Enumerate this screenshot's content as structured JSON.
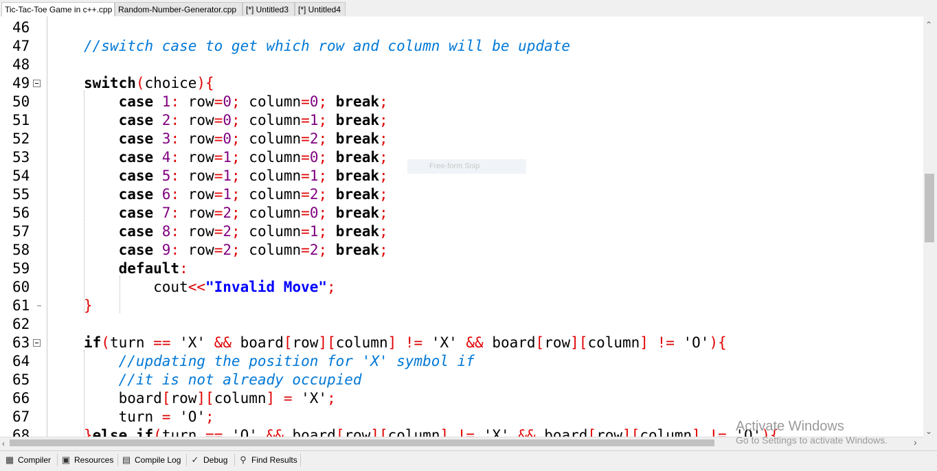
{
  "tabs": [
    {
      "label": "Tic-Tac-Toe Game in c++.cpp",
      "active": true
    },
    {
      "label": "Random-Number-Generator.cpp",
      "active": false
    },
    {
      "label": "[*] Untitled3",
      "active": false
    },
    {
      "label": "[*] Untitled4",
      "active": false
    }
  ],
  "editor": {
    "lines": [
      {
        "num": "46",
        "tokens": []
      },
      {
        "num": "47",
        "tokens": [
          {
            "t": "//switch case to get which row and column will be update",
            "c": "cmt"
          }
        ]
      },
      {
        "num": "48",
        "tokens": []
      },
      {
        "num": "49",
        "fold": true,
        "tokens": [
          {
            "t": "switch",
            "c": "kw"
          },
          {
            "t": "(",
            "c": "op"
          },
          {
            "t": "choice",
            "c": "id"
          },
          {
            "t": "){",
            "c": "op"
          }
        ]
      },
      {
        "num": "50",
        "tokens": [
          {
            "t": "    case ",
            "c": "kw"
          },
          {
            "t": "1",
            "c": "num"
          },
          {
            "t": ": ",
            "c": "op"
          },
          {
            "t": "row",
            "c": "id"
          },
          {
            "t": "=",
            "c": "op"
          },
          {
            "t": "0",
            "c": "num"
          },
          {
            "t": "; ",
            "c": "op"
          },
          {
            "t": "column",
            "c": "id"
          },
          {
            "t": "=",
            "c": "op"
          },
          {
            "t": "0",
            "c": "num"
          },
          {
            "t": "; ",
            "c": "op"
          },
          {
            "t": "break",
            "c": "kw"
          },
          {
            "t": ";",
            "c": "op"
          }
        ]
      },
      {
        "num": "51",
        "tokens": [
          {
            "t": "    case ",
            "c": "kw"
          },
          {
            "t": "2",
            "c": "num"
          },
          {
            "t": ": ",
            "c": "op"
          },
          {
            "t": "row",
            "c": "id"
          },
          {
            "t": "=",
            "c": "op"
          },
          {
            "t": "0",
            "c": "num"
          },
          {
            "t": "; ",
            "c": "op"
          },
          {
            "t": "column",
            "c": "id"
          },
          {
            "t": "=",
            "c": "op"
          },
          {
            "t": "1",
            "c": "num"
          },
          {
            "t": "; ",
            "c": "op"
          },
          {
            "t": "break",
            "c": "kw"
          },
          {
            "t": ";",
            "c": "op"
          }
        ]
      },
      {
        "num": "52",
        "tokens": [
          {
            "t": "    case ",
            "c": "kw"
          },
          {
            "t": "3",
            "c": "num"
          },
          {
            "t": ": ",
            "c": "op"
          },
          {
            "t": "row",
            "c": "id"
          },
          {
            "t": "=",
            "c": "op"
          },
          {
            "t": "0",
            "c": "num"
          },
          {
            "t": "; ",
            "c": "op"
          },
          {
            "t": "column",
            "c": "id"
          },
          {
            "t": "=",
            "c": "op"
          },
          {
            "t": "2",
            "c": "num"
          },
          {
            "t": "; ",
            "c": "op"
          },
          {
            "t": "break",
            "c": "kw"
          },
          {
            "t": ";",
            "c": "op"
          }
        ]
      },
      {
        "num": "53",
        "tokens": [
          {
            "t": "    case ",
            "c": "kw"
          },
          {
            "t": "4",
            "c": "num"
          },
          {
            "t": ": ",
            "c": "op"
          },
          {
            "t": "row",
            "c": "id"
          },
          {
            "t": "=",
            "c": "op"
          },
          {
            "t": "1",
            "c": "num"
          },
          {
            "t": "; ",
            "c": "op"
          },
          {
            "t": "column",
            "c": "id"
          },
          {
            "t": "=",
            "c": "op"
          },
          {
            "t": "0",
            "c": "num"
          },
          {
            "t": "; ",
            "c": "op"
          },
          {
            "t": "break",
            "c": "kw"
          },
          {
            "t": ";",
            "c": "op"
          }
        ]
      },
      {
        "num": "54",
        "tokens": [
          {
            "t": "    case ",
            "c": "kw"
          },
          {
            "t": "5",
            "c": "num"
          },
          {
            "t": ": ",
            "c": "op"
          },
          {
            "t": "row",
            "c": "id"
          },
          {
            "t": "=",
            "c": "op"
          },
          {
            "t": "1",
            "c": "num"
          },
          {
            "t": "; ",
            "c": "op"
          },
          {
            "t": "column",
            "c": "id"
          },
          {
            "t": "=",
            "c": "op"
          },
          {
            "t": "1",
            "c": "num"
          },
          {
            "t": "; ",
            "c": "op"
          },
          {
            "t": "break",
            "c": "kw"
          },
          {
            "t": ";",
            "c": "op"
          }
        ]
      },
      {
        "num": "55",
        "tokens": [
          {
            "t": "    case ",
            "c": "kw"
          },
          {
            "t": "6",
            "c": "num"
          },
          {
            "t": ": ",
            "c": "op"
          },
          {
            "t": "row",
            "c": "id"
          },
          {
            "t": "=",
            "c": "op"
          },
          {
            "t": "1",
            "c": "num"
          },
          {
            "t": "; ",
            "c": "op"
          },
          {
            "t": "column",
            "c": "id"
          },
          {
            "t": "=",
            "c": "op"
          },
          {
            "t": "2",
            "c": "num"
          },
          {
            "t": "; ",
            "c": "op"
          },
          {
            "t": "break",
            "c": "kw"
          },
          {
            "t": ";",
            "c": "op"
          }
        ]
      },
      {
        "num": "56",
        "tokens": [
          {
            "t": "    case ",
            "c": "kw"
          },
          {
            "t": "7",
            "c": "num"
          },
          {
            "t": ": ",
            "c": "op"
          },
          {
            "t": "row",
            "c": "id"
          },
          {
            "t": "=",
            "c": "op"
          },
          {
            "t": "2",
            "c": "num"
          },
          {
            "t": "; ",
            "c": "op"
          },
          {
            "t": "column",
            "c": "id"
          },
          {
            "t": "=",
            "c": "op"
          },
          {
            "t": "0",
            "c": "num"
          },
          {
            "t": "; ",
            "c": "op"
          },
          {
            "t": "break",
            "c": "kw"
          },
          {
            "t": ";",
            "c": "op"
          }
        ]
      },
      {
        "num": "57",
        "tokens": [
          {
            "t": "    case ",
            "c": "kw"
          },
          {
            "t": "8",
            "c": "num"
          },
          {
            "t": ": ",
            "c": "op"
          },
          {
            "t": "row",
            "c": "id"
          },
          {
            "t": "=",
            "c": "op"
          },
          {
            "t": "2",
            "c": "num"
          },
          {
            "t": "; ",
            "c": "op"
          },
          {
            "t": "column",
            "c": "id"
          },
          {
            "t": "=",
            "c": "op"
          },
          {
            "t": "1",
            "c": "num"
          },
          {
            "t": "; ",
            "c": "op"
          },
          {
            "t": "break",
            "c": "kw"
          },
          {
            "t": ";",
            "c": "op"
          }
        ]
      },
      {
        "num": "58",
        "tokens": [
          {
            "t": "    case ",
            "c": "kw"
          },
          {
            "t": "9",
            "c": "num"
          },
          {
            "t": ": ",
            "c": "op"
          },
          {
            "t": "row",
            "c": "id"
          },
          {
            "t": "=",
            "c": "op"
          },
          {
            "t": "2",
            "c": "num"
          },
          {
            "t": "; ",
            "c": "op"
          },
          {
            "t": "column",
            "c": "id"
          },
          {
            "t": "=",
            "c": "op"
          },
          {
            "t": "2",
            "c": "num"
          },
          {
            "t": "; ",
            "c": "op"
          },
          {
            "t": "break",
            "c": "kw"
          },
          {
            "t": ";",
            "c": "op"
          }
        ]
      },
      {
        "num": "59",
        "tokens": [
          {
            "t": "    default",
            "c": "kw"
          },
          {
            "t": ":",
            "c": "op"
          }
        ]
      },
      {
        "num": "60",
        "tokens": [
          {
            "t": "        cout",
            "c": "id"
          },
          {
            "t": "<<",
            "c": "op"
          },
          {
            "t": "\"Invalid Move\"",
            "c": "str"
          },
          {
            "t": ";",
            "c": "op"
          }
        ]
      },
      {
        "num": "61",
        "foldEnd": true,
        "tokens": [
          {
            "t": "}",
            "c": "op"
          }
        ]
      },
      {
        "num": "62",
        "tokens": []
      },
      {
        "num": "63",
        "fold": true,
        "tokens": [
          {
            "t": "if",
            "c": "kw"
          },
          {
            "t": "(",
            "c": "op"
          },
          {
            "t": "turn ",
            "c": "id"
          },
          {
            "t": "==",
            "c": "op"
          },
          {
            "t": " 'X' ",
            "c": "chr"
          },
          {
            "t": "&&",
            "c": "op"
          },
          {
            "t": " board",
            "c": "id"
          },
          {
            "t": "[",
            "c": "op"
          },
          {
            "t": "row",
            "c": "id"
          },
          {
            "t": "][",
            "c": "op"
          },
          {
            "t": "column",
            "c": "id"
          },
          {
            "t": "] != ",
            "c": "op"
          },
          {
            "t": "'X' ",
            "c": "chr"
          },
          {
            "t": "&&",
            "c": "op"
          },
          {
            "t": " board",
            "c": "id"
          },
          {
            "t": "[",
            "c": "op"
          },
          {
            "t": "row",
            "c": "id"
          },
          {
            "t": "][",
            "c": "op"
          },
          {
            "t": "column",
            "c": "id"
          },
          {
            "t": "] != ",
            "c": "op"
          },
          {
            "t": "'O'",
            "c": "chr"
          },
          {
            "t": "){",
            "c": "op"
          }
        ]
      },
      {
        "num": "64",
        "tokens": [
          {
            "t": "    //updating the position for 'X' symbol if",
            "c": "cmt"
          }
        ]
      },
      {
        "num": "65",
        "tokens": [
          {
            "t": "    //it is not already occupied",
            "c": "cmt"
          }
        ]
      },
      {
        "num": "66",
        "tokens": [
          {
            "t": "    board",
            "c": "id"
          },
          {
            "t": "[",
            "c": "op"
          },
          {
            "t": "row",
            "c": "id"
          },
          {
            "t": "][",
            "c": "op"
          },
          {
            "t": "column",
            "c": "id"
          },
          {
            "t": "] = ",
            "c": "op"
          },
          {
            "t": "'X'",
            "c": "chr"
          },
          {
            "t": ";",
            "c": "op"
          }
        ]
      },
      {
        "num": "67",
        "tokens": [
          {
            "t": "    turn ",
            "c": "id"
          },
          {
            "t": "=",
            "c": "op"
          },
          {
            "t": " 'O'",
            "c": "chr"
          },
          {
            "t": ";",
            "c": "op"
          }
        ]
      },
      {
        "num": "68",
        "tokens": [
          {
            "t": "}",
            "c": "op"
          },
          {
            "t": "else ",
            "c": "kw"
          },
          {
            "t": "if",
            "c": "kw"
          },
          {
            "t": "(",
            "c": "op"
          },
          {
            "t": "turn ",
            "c": "id"
          },
          {
            "t": "==",
            "c": "op"
          },
          {
            "t": " 'O' ",
            "c": "chr"
          },
          {
            "t": "&&",
            "c": "op"
          },
          {
            "t": " board",
            "c": "id"
          },
          {
            "t": "[",
            "c": "op"
          },
          {
            "t": "row",
            "c": "id"
          },
          {
            "t": "][",
            "c": "op"
          },
          {
            "t": "column",
            "c": "id"
          },
          {
            "t": "] != ",
            "c": "op"
          },
          {
            "t": "'X' ",
            "c": "chr"
          },
          {
            "t": "&&",
            "c": "op"
          },
          {
            "t": " board",
            "c": "id"
          },
          {
            "t": "[",
            "c": "op"
          },
          {
            "t": "row",
            "c": "id"
          },
          {
            "t": "][",
            "c": "op"
          },
          {
            "t": "column",
            "c": "id"
          },
          {
            "t": "] != ",
            "c": "op"
          },
          {
            "t": "'O'",
            "c": "chr"
          },
          {
            "t": "){",
            "c": "op"
          }
        ]
      }
    ]
  },
  "overlay": {
    "snip_label": "Free-form Snip"
  },
  "watermark": {
    "title": "Activate Windows",
    "subtitle": "Go to Settings to activate Windows."
  },
  "bottom_tabs": [
    {
      "label": "Compiler",
      "icon": "compiler-grid-icon"
    },
    {
      "label": "Resources",
      "icon": "resources-icon"
    },
    {
      "label": "Compile Log",
      "icon": "compile-log-chart-icon"
    },
    {
      "label": "Debug",
      "icon": "debug-check-icon"
    },
    {
      "label": "Find Results",
      "icon": "find-results-icon"
    }
  ],
  "colors": {
    "keyword": "#000000",
    "number": "#800080",
    "operator": "#e00000",
    "string": "#0000ff",
    "comment": "#0078d7"
  }
}
